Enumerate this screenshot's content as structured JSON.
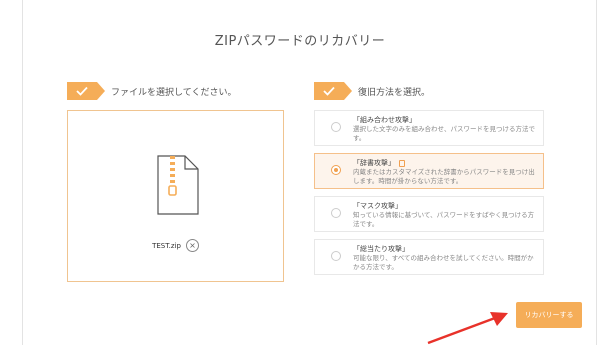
{
  "title": "ZIPパスワードのリカバリー",
  "step1": {
    "label": "ファイルを選択してください。"
  },
  "step2": {
    "label": "復旧方法を選択。"
  },
  "file": {
    "name": "TEST.zip"
  },
  "options": [
    {
      "name": "「組み合わせ攻撃」",
      "desc": "選択した文字のみを組み合わせ、パスワードを見つける方法です。",
      "selected": false
    },
    {
      "name": "「辞書攻撃」",
      "desc": "内蔵またはカスタマイズされた辞書からパスワードを見つけ出します。時間が掛からない方法です。",
      "selected": true,
      "recommended_icon": "document-icon"
    },
    {
      "name": "「マスク攻撃」",
      "desc": "知っている情報に基づいて、パスワードをすばやく見つける方法です。",
      "selected": false
    },
    {
      "name": "「総当たり攻撃」",
      "desc": "可能な限り、すべての組み合わせを試してください。時間がかかる方法です。",
      "selected": false
    }
  ],
  "recover_button": {
    "label": "リカバリーする"
  },
  "colors": {
    "accent": "#f5ad58",
    "arrow": "#e8322a"
  }
}
